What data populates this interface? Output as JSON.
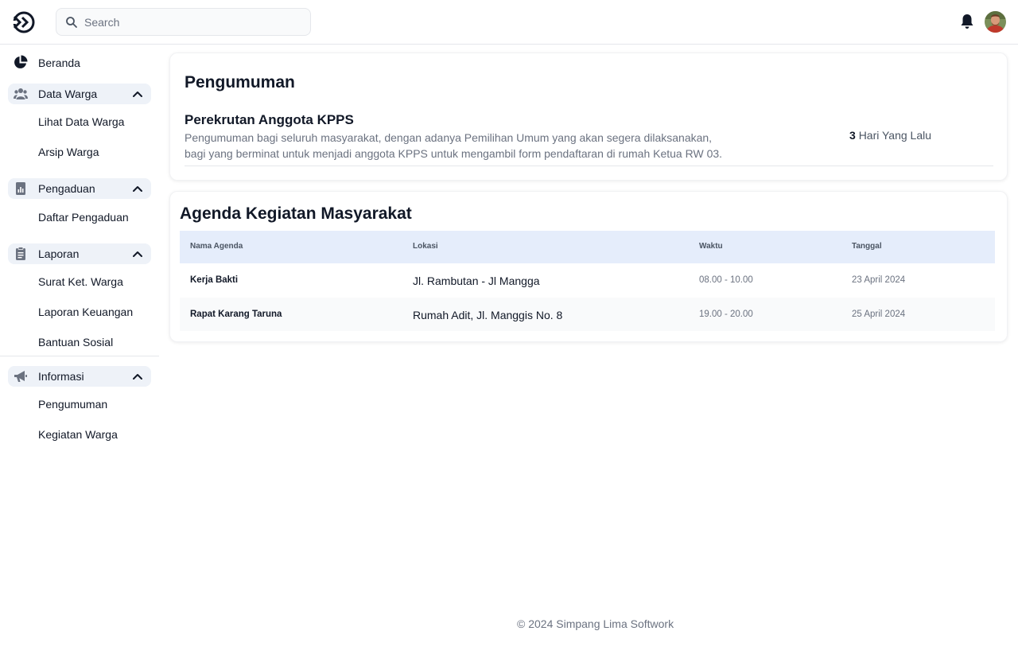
{
  "search": {
    "placeholder": "Search"
  },
  "sidebar": {
    "home": {
      "label": "Beranda",
      "icon": "pie-chart-icon"
    },
    "groups": [
      {
        "label": "Data Warga",
        "icon": "users-icon",
        "items": [
          "Lihat Data Warga",
          "Arsip Warga"
        ]
      },
      {
        "label": "Pengaduan",
        "icon": "report-icon",
        "items": [
          "Daftar Pengaduan"
        ]
      },
      {
        "label": "Laporan",
        "icon": "clipboard-icon",
        "items": [
          "Surat Ket. Warga",
          "Laporan Keuangan",
          "Bantuan Sosial"
        ]
      },
      {
        "label": "Informasi",
        "icon": "megaphone-icon",
        "items": [
          "Pengumuman",
          "Kegiatan Warga"
        ]
      }
    ]
  },
  "announcements": {
    "title": "Pengumuman",
    "items": [
      {
        "title": "Perekrutan Anggota KPPS",
        "body": "Pengumuman bagi seluruh masyarakat, dengan adanya Pemilihan Umum yang akan segera dilaksanakan, bagi yang berminat untuk menjadi anggota KPPS untuk mengambil form pendaftaran di rumah Ketua RW 03.",
        "time_value": "3",
        "time_unit": "Hari Yang Lalu"
      }
    ]
  },
  "agenda": {
    "title": "Agenda Kegiatan Masyarakat",
    "columns": [
      "Nama Agenda",
      "Lokasi",
      "Waktu",
      "Tanggal"
    ],
    "rows": [
      {
        "name": "Kerja Bakti",
        "location": "Jl. Rambutan - Jl Mangga",
        "time": "08.00 - 10.00",
        "date": "23 April 2024"
      },
      {
        "name": "Rapat Karang Taruna",
        "location": "Rumah Adit, Jl. Manggis No. 8",
        "time": "19.00 - 20.00",
        "date": "25 April 2024"
      }
    ]
  },
  "footer": {
    "text": "© 2024 Simpang Lima Softwork"
  },
  "colors": {
    "accent_bg": "#eef2f8",
    "table_header": "#e5edfb",
    "muted_text": "#6b7280"
  }
}
